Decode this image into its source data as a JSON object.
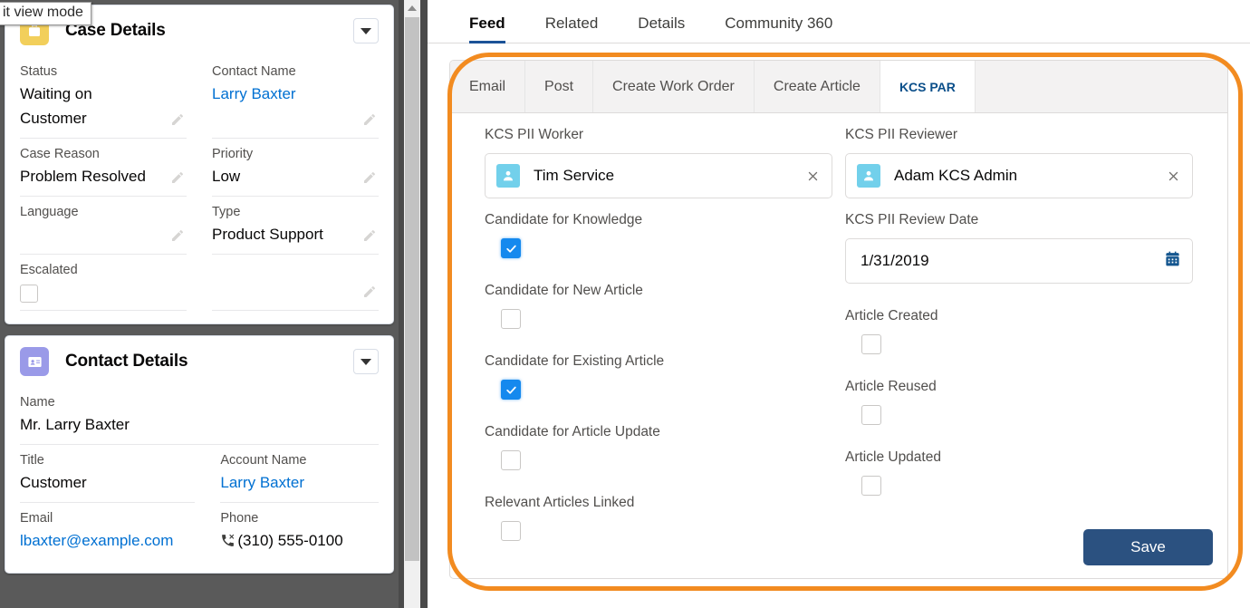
{
  "tooltip": {
    "text": "it view mode"
  },
  "left_panel": {
    "cards": [
      {
        "title": "Case Details",
        "icon": "briefcase-icon",
        "chevron": "chevron-down-icon",
        "fields": [
          {
            "label": "Status",
            "value": "Waiting on Customer",
            "link": false,
            "type": "text",
            "col": "left"
          },
          {
            "label": "Contact Name",
            "value": "Larry Baxter",
            "link": true,
            "type": "text",
            "col": "right"
          },
          {
            "label": "Case Reason",
            "value": "Problem Resolved",
            "link": false,
            "type": "text",
            "col": "left"
          },
          {
            "label": "Priority",
            "value": "Low",
            "link": false,
            "type": "text",
            "col": "right"
          },
          {
            "label": "Language",
            "value": "",
            "link": false,
            "type": "text",
            "col": "left"
          },
          {
            "label": "Type",
            "value": "Product Support",
            "link": false,
            "type": "text",
            "col": "right"
          },
          {
            "label": "Escalated",
            "value": "",
            "link": false,
            "type": "checkbox",
            "checked": false,
            "col": "left"
          },
          {
            "label": "",
            "value": "",
            "link": false,
            "type": "text",
            "col": "right"
          }
        ]
      },
      {
        "title": "Contact Details",
        "icon": "contact-card-icon",
        "chevron": "chevron-down-icon",
        "fields": [
          {
            "label": "Name",
            "value": "Mr. Larry Baxter",
            "link": false,
            "type": "text",
            "col": "full"
          },
          {
            "label": "Title",
            "value": "Customer",
            "link": false,
            "type": "text",
            "col": "left"
          },
          {
            "label": "Account Name",
            "value": "Larry Baxter",
            "link": true,
            "type": "text",
            "col": "right"
          },
          {
            "label": "Email",
            "value": "lbaxter@example.com",
            "link": true,
            "type": "text",
            "col": "left"
          },
          {
            "label": "Phone",
            "value": "(310) 555-0100",
            "link": false,
            "type": "phone",
            "col": "right"
          }
        ]
      }
    ]
  },
  "scrollbar": {
    "up_arrow": "scroll-up-arrow-icon"
  },
  "right_panel": {
    "top_tabs": [
      {
        "label": "Feed",
        "active": true
      },
      {
        "label": "Related",
        "active": false
      },
      {
        "label": "Details",
        "active": false
      },
      {
        "label": "Community 360",
        "active": false
      }
    ],
    "publisher": {
      "tabs": [
        {
          "label": "Email",
          "active": false
        },
        {
          "label": "Post",
          "active": false
        },
        {
          "label": "Create Work Order",
          "active": false
        },
        {
          "label": "Create Article",
          "active": false
        },
        {
          "label": "KCS PAR",
          "active": true
        }
      ],
      "left_fields": [
        {
          "label": "KCS PII Worker",
          "type": "lookup",
          "value": "Tim Service",
          "avatar": "user-avatar-icon",
          "clear": "clear-icon"
        },
        {
          "label": "Candidate for Knowledge",
          "type": "checkbox",
          "checked": true
        },
        {
          "label": "Candidate for New Article",
          "type": "checkbox",
          "checked": false
        },
        {
          "label": "Candidate for Existing Article",
          "type": "checkbox",
          "checked": true
        },
        {
          "label": "Candidate for Article Update",
          "type": "checkbox",
          "checked": false
        },
        {
          "label": "Relevant Articles Linked",
          "type": "checkbox",
          "checked": false
        }
      ],
      "right_fields": [
        {
          "label": "KCS PII Reviewer",
          "type": "lookup",
          "value": "Adam KCS Admin",
          "avatar": "user-avatar-icon",
          "clear": "clear-icon"
        },
        {
          "label": "KCS PII Review Date",
          "type": "date",
          "value": "1/31/2019",
          "icon": "calendar-icon"
        },
        {
          "label": "Article Created",
          "type": "checkbox",
          "checked": false
        },
        {
          "label": "Article Reused",
          "type": "checkbox",
          "checked": false
        },
        {
          "label": "Article Updated",
          "type": "checkbox",
          "checked": false
        }
      ],
      "save_label": "Save"
    }
  },
  "annotation": {
    "type": "orange-highlight-rect",
    "color": "#f28b20"
  },
  "colors": {
    "accent_blue": "#0070d2",
    "checkbox_blue": "#1589ee",
    "save_navy": "#2b5180",
    "highlight_orange": "#f28b20",
    "case_icon_yellow": "#f2cf5b",
    "contact_icon_purple": "#9a9ae8",
    "avatar_cyan": "#72d0eb",
    "tab_underline": "#1b5297"
  }
}
